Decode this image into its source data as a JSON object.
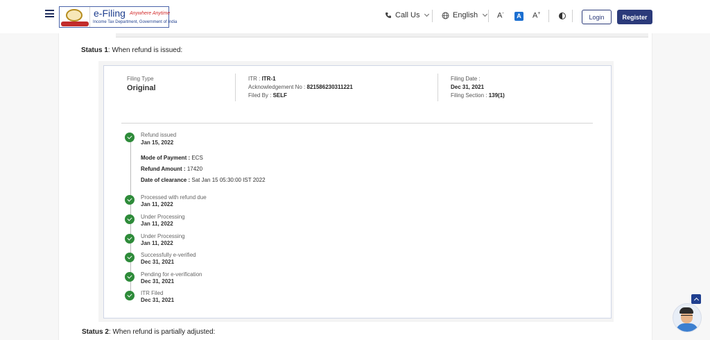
{
  "header": {
    "logo": {
      "name": "e-Filing",
      "tagline": "Anywhere Anytime",
      "department": "Income Tax Department, Government of India"
    },
    "call_us": "Call Us",
    "language": "English",
    "font_decrease": "A",
    "font_reset": "A",
    "font_increase": "A",
    "font_decrease_sup": "-",
    "font_increase_sup": "+",
    "login": "Login",
    "register": "Register"
  },
  "status1": {
    "prefix": "Status 1",
    "text": ": When refund is issued:"
  },
  "status2": {
    "prefix": "Status 2",
    "text": ": When refund is partially adjusted:"
  },
  "summary": {
    "filing_type_label": "Filing Type",
    "filing_type_value": "Original",
    "itr_label": "ITR : ",
    "itr_value": "ITR-1",
    "ack_label": "Acknowledgement No : ",
    "ack_value": "821586230311221",
    "filed_by_label": "Filed By : ",
    "filed_by_value": "SELF",
    "filing_date_label": "Filing Date :",
    "filing_date_value": "Dec 31, 2021",
    "filing_section_label": "Filing Section : ",
    "filing_section_value": "139(1)"
  },
  "refund_details": {
    "mode_label": "Mode of Payment : ",
    "mode_value": "ECS",
    "amount_label": "Refund Amount : ",
    "amount_value": "17420",
    "clearance_label": "Date of clearance : ",
    "clearance_value": "Sat Jan 15 05:30:00 IST 2022"
  },
  "timeline": [
    {
      "label": "Refund issued",
      "date": "Jan 15, 2022"
    },
    {
      "label": "Processed with refund due",
      "date": "Jan 11, 2022"
    },
    {
      "label": "Under Processing",
      "date": "Jan 11, 2022"
    },
    {
      "label": "Under Processing",
      "date": "Jan 11, 2022"
    },
    {
      "label": "Successfully e-verified",
      "date": "Dec 31, 2021"
    },
    {
      "label": "Pending for e-verification",
      "date": "Dec 31, 2021"
    },
    {
      "label": "ITR Filed",
      "date": "Dec 31, 2021"
    }
  ],
  "colors": {
    "primary": "#2b3a7a",
    "check": "#2e8b3a",
    "accent": "#1c6fd1"
  }
}
